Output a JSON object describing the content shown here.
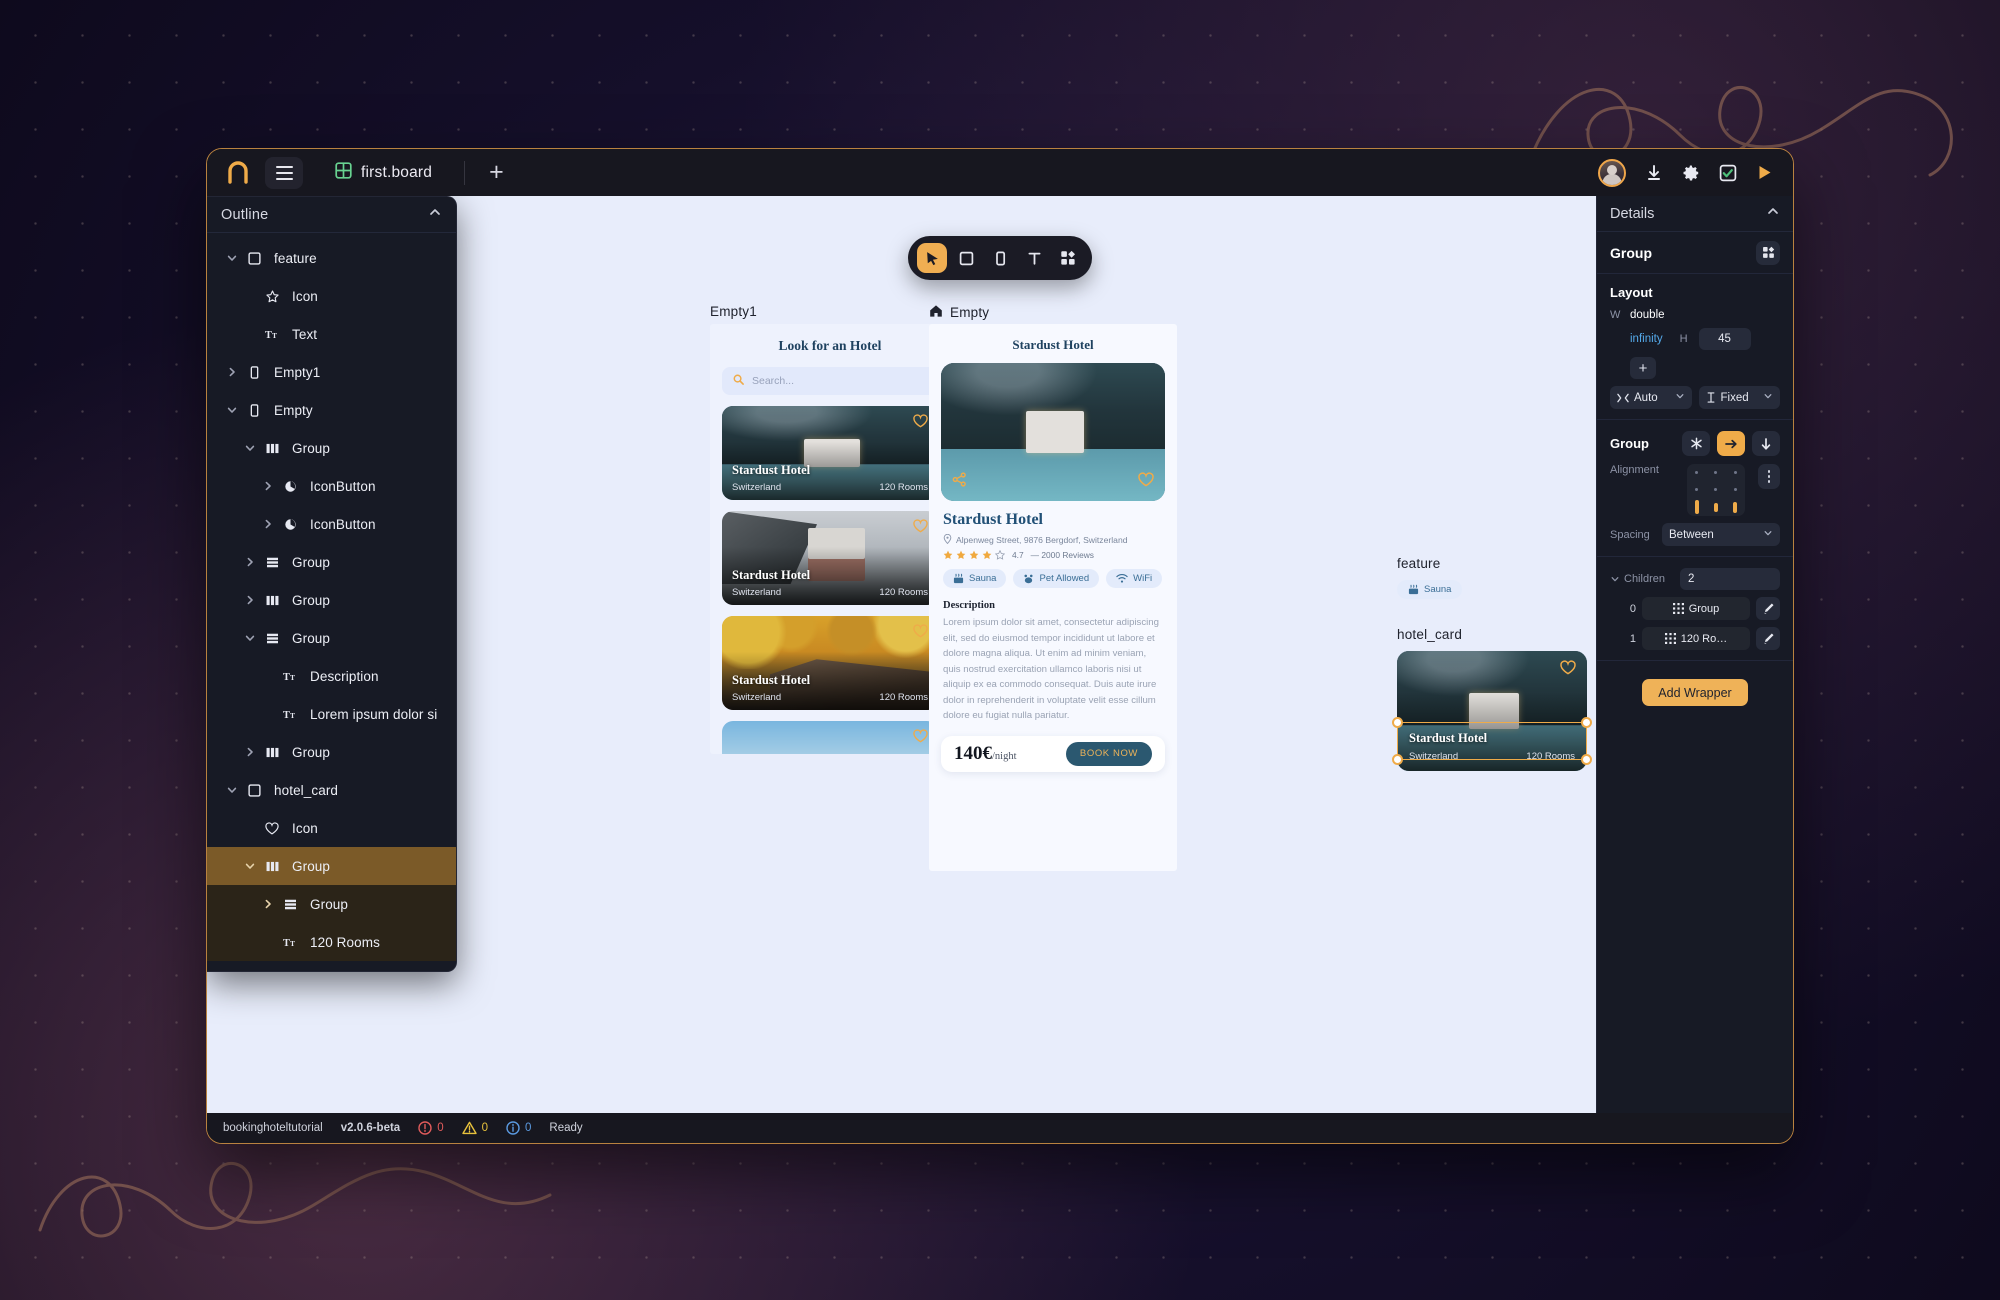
{
  "titlebar": {
    "logo_icon": "omega-logo-icon",
    "menu_icon": "hamburger-icon",
    "board_icon": "board-grid-icon",
    "tab_name": "first.board",
    "new_tab_label": "+",
    "right_icons": [
      "avatar",
      "download-icon",
      "gear-icon",
      "checkbox-check-icon",
      "play-icon"
    ]
  },
  "outline": {
    "title": "Outline",
    "collapse_icon": "chevron-up-icon",
    "items": [
      {
        "label": "feature",
        "icon": "square-icon",
        "twisty": "chevron-down-icon",
        "indent": 0,
        "state": "none"
      },
      {
        "label": "Icon",
        "icon": "star-icon",
        "twisty": "",
        "indent": 1,
        "state": "none"
      },
      {
        "label": "Text",
        "icon": "text-icon",
        "twisty": "",
        "indent": 1,
        "state": "none"
      },
      {
        "label": "Empty1",
        "icon": "phone-icon",
        "twisty": "chevron-right-icon",
        "indent": 0,
        "state": "none"
      },
      {
        "label": "Empty",
        "icon": "phone-icon",
        "twisty": "chevron-down-icon",
        "indent": 0,
        "state": "none"
      },
      {
        "label": "Group",
        "icon": "columns-icon",
        "twisty": "chevron-down-icon",
        "indent": 1,
        "state": "none"
      },
      {
        "label": "IconButton",
        "icon": "circle-icon",
        "twisty": "chevron-right-icon",
        "indent": 2,
        "state": "none"
      },
      {
        "label": "IconButton",
        "icon": "circle-icon",
        "twisty": "chevron-right-icon",
        "indent": 2,
        "state": "none"
      },
      {
        "label": "Group",
        "icon": "rows-icon",
        "twisty": "chevron-right-icon",
        "indent": 1,
        "state": "none"
      },
      {
        "label": "Group",
        "icon": "columns-icon",
        "twisty": "chevron-right-icon",
        "indent": 1,
        "state": "none"
      },
      {
        "label": "Group",
        "icon": "rows-icon",
        "twisty": "chevron-down-icon",
        "indent": 1,
        "state": "none"
      },
      {
        "label": "Description",
        "icon": "text-icon",
        "twisty": "",
        "indent": 2,
        "state": "none"
      },
      {
        "label": "Lorem ipsum dolor si",
        "icon": "text-icon",
        "twisty": "",
        "indent": 2,
        "state": "none"
      },
      {
        "label": "Group",
        "icon": "columns-icon",
        "twisty": "chevron-right-icon",
        "indent": 1,
        "state": "none"
      },
      {
        "label": "hotel_card",
        "icon": "square-icon",
        "twisty": "chevron-down-icon",
        "indent": 0,
        "state": "none"
      },
      {
        "label": "Icon",
        "icon": "heart-icon",
        "twisty": "",
        "indent": 1,
        "state": "none"
      },
      {
        "label": "Group",
        "icon": "columns-icon",
        "twisty": "chevron-down-icon",
        "indent": 1,
        "state": "selected"
      },
      {
        "label": "Group",
        "icon": "rows-icon",
        "twisty": "chevron-right-icon",
        "indent": 2,
        "state": "selected-child"
      },
      {
        "label": "120 Rooms",
        "icon": "text-icon",
        "twisty": "",
        "indent": 2,
        "state": "selected-child"
      }
    ]
  },
  "toolbar": {
    "tools": [
      {
        "name": "select-tool",
        "icon": "cursor-icon",
        "active": true
      },
      {
        "name": "frame-tool",
        "icon": "square-icon",
        "active": false
      },
      {
        "name": "device-tool",
        "icon": "phone-icon",
        "active": false
      },
      {
        "name": "text-tool",
        "icon": "text-T-icon",
        "active": false
      },
      {
        "name": "component-tool",
        "icon": "component-icon",
        "active": false
      }
    ]
  },
  "canvas": {
    "board_empty1": {
      "label": "Empty1",
      "heading": "Look for an Hotel",
      "search_placeholder": "Search...",
      "search_icon": "search-icon",
      "cards": [
        {
          "name": "Stardust Hotel",
          "country": "Switzerland",
          "rooms": "120 Rooms",
          "photo": "lake"
        },
        {
          "name": "Stardust Hotel",
          "country": "Switzerland",
          "rooms": "120 Rooms",
          "photo": "snow"
        },
        {
          "name": "Stardust Hotel",
          "country": "Switzerland",
          "rooms": "120 Rooms",
          "photo": "autumn"
        },
        {
          "name": "",
          "country": "",
          "rooms": "",
          "photo": "winter"
        }
      ]
    },
    "board_empty": {
      "label": "Empty",
      "label_icon": "home-icon",
      "heading": "Stardust Hotel",
      "photo": "lake",
      "share_icon": "share-icon",
      "heart_icon": "heart-icon",
      "hotel_name": "Stardust Hotel",
      "address": "Alpenweg Street, 9876 Bergdorf, Switzerland",
      "address_icon": "pin-icon",
      "rating_value": "4.7",
      "rating_stars_filled": 4,
      "rating_stars_total": 5,
      "reviews": "— 2000 Reviews",
      "chips": [
        {
          "label": "Sauna",
          "icon": "sauna-icon"
        },
        {
          "label": "Pet Allowed",
          "icon": "pet-icon"
        },
        {
          "label": "WiFi",
          "icon": "wifi-icon"
        }
      ],
      "description_heading": "Description",
      "description": "Lorem ipsum dolor sit amet, consectetur adipiscing elit, sed do eiusmod tempor incididunt ut labore et dolore magna aliqua. Ut enim ad minim veniam, quis nostrud exercitation ullamco laboris nisi ut aliquip ex ea commodo consequat. Duis aute irure dolor in reprehenderit in voluptate velit esse cillum dolore eu fugiat nulla pariatur.",
      "price": "140€",
      "price_unit": "/night",
      "book_label": "BOOK NOW"
    },
    "feature_block": {
      "label": "feature",
      "chip_label": "Sauna",
      "chip_icon": "sauna-icon"
    },
    "hotelcard_block": {
      "label": "hotel_card",
      "name": "Stardust Hotel",
      "country": "Switzerland",
      "rooms": "120 Rooms",
      "heart_icon": "heart-icon",
      "photo": "lake",
      "selection_color": "#efab49"
    }
  },
  "details": {
    "title": "Details",
    "collapse_icon": "chevron-up-icon",
    "type_name": "Group",
    "type_icon": "component-icon",
    "layout": {
      "heading": "Layout",
      "w_label": "W",
      "w_value": "double",
      "w_value2": "infinity",
      "h_label": "H",
      "h_value": "45",
      "add_label": "+",
      "size_mode_left": "Auto",
      "size_mode_left_icon": "hug-icon",
      "size_mode_right": "Fixed",
      "size_mode_right_icon": "fixed-icon"
    },
    "group": {
      "heading": "Group",
      "mode_buttons": [
        {
          "name": "stack-free-button",
          "icon": "asterisk-icon",
          "active": false
        },
        {
          "name": "stack-horizontal-button",
          "icon": "arrow-right-icon",
          "active": true
        },
        {
          "name": "stack-vertical-button",
          "icon": "arrow-down-icon",
          "active": false
        }
      ],
      "alignment_label": "Alignment",
      "alignment_selected": "bottom",
      "more_icon": "more-vertical-icon",
      "spacing_label": "Spacing",
      "spacing_value": "Between"
    },
    "children": {
      "label": "Children",
      "twisty": "chevron-down-icon",
      "count": "2",
      "rows": [
        {
          "index": "0",
          "label": "Group",
          "icon": "grid-icon",
          "edit_icon": "brush-icon"
        },
        {
          "index": "1",
          "label": "120 Ro…",
          "icon": "grid-icon",
          "edit_icon": "brush-icon"
        }
      ]
    },
    "add_wrapper_label": "Add Wrapper"
  },
  "statusbar": {
    "project": "bookinghoteltutorial",
    "version": "v2.0.6-beta",
    "errors": "0",
    "warnings": "0",
    "infos": "0",
    "state": "Ready",
    "error_icon": "error-circle-icon",
    "warning_icon": "warning-triangle-icon",
    "info_icon": "info-circle-icon"
  }
}
